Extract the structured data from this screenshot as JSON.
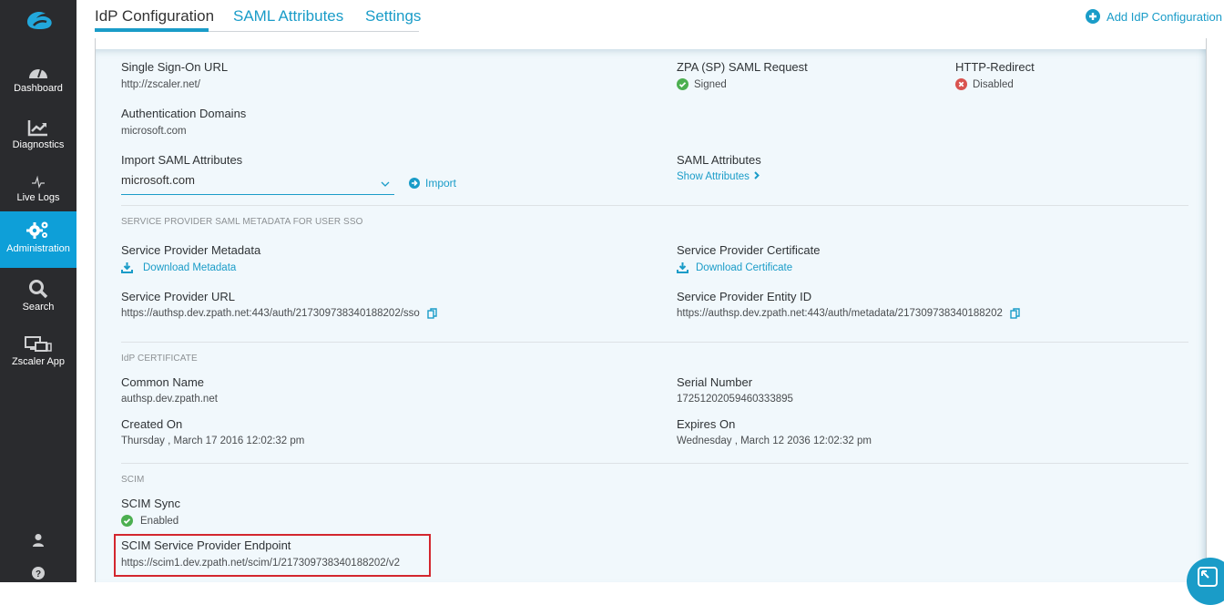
{
  "sidebar": {
    "logo": "zscaler-logo",
    "items": [
      {
        "label": "Dashboard",
        "icon": "gauge-icon",
        "active": false
      },
      {
        "label": "Diagnostics",
        "icon": "chart-trend-icon",
        "active": false
      },
      {
        "label": "Live Logs",
        "icon": "pulse-icon",
        "active": false
      },
      {
        "label": "Administration",
        "icon": "gears-icon",
        "active": true
      },
      {
        "label": "Search",
        "icon": "search-icon",
        "active": false
      },
      {
        "label": "Zscaler App",
        "icon": "devices-icon",
        "active": false
      }
    ],
    "bottom": [
      {
        "icon": "user-icon"
      },
      {
        "icon": "help-icon"
      }
    ]
  },
  "tabs": [
    {
      "label": "IdP Configuration",
      "active": true
    },
    {
      "label": "SAML Attributes",
      "active": false
    },
    {
      "label": "Settings",
      "active": false
    }
  ],
  "header": {
    "add_button": "Add IdP Configuration"
  },
  "colors": {
    "accent": "#1a9cc8",
    "sidebar_bg": "#2a2b2e",
    "active_nav": "#0e9fd8",
    "success": "#4caf50",
    "error": "#d9534f",
    "highlight": "#d3262e"
  },
  "config": {
    "sso_url": {
      "label": "Single Sign-On URL",
      "value": "http://zscaler.net/"
    },
    "sp_saml_request": {
      "label": "ZPA (SP) SAML Request",
      "value": "Signed",
      "status": "success"
    },
    "http_redirect": {
      "label": "HTTP-Redirect",
      "value": "Disabled",
      "status": "error"
    },
    "auth_domains": {
      "label": "Authentication Domains",
      "value": "microsoft.com"
    },
    "import_saml": {
      "label": "Import SAML Attributes",
      "selected": "microsoft.com",
      "import_button": "Import"
    },
    "saml_attributes": {
      "label": "SAML Attributes",
      "link": "Show Attributes"
    }
  },
  "sp_metadata": {
    "section_title": "SERVICE PROVIDER SAML METADATA FOR USER SSO",
    "metadata": {
      "label": "Service Provider Metadata",
      "link": "Download Metadata"
    },
    "certificate": {
      "label": "Service Provider Certificate",
      "link": "Download Certificate"
    },
    "url": {
      "label": "Service Provider URL",
      "value": "https://authsp.dev.zpath.net:443/auth/217309738340188202/sso"
    },
    "entity_id": {
      "label": "Service Provider Entity ID",
      "value": "https://authsp.dev.zpath.net:443/auth/metadata/217309738340188202"
    }
  },
  "idp_certificate": {
    "section_title": "IdP CERTIFICATE",
    "common_name": {
      "label": "Common Name",
      "value": "authsp.dev.zpath.net"
    },
    "serial_number": {
      "label": "Serial Number",
      "value": "17251202059460333895"
    },
    "created_on": {
      "label": "Created On",
      "value": "Thursday , March 17 2016 12:02:32 pm"
    },
    "expires_on": {
      "label": "Expires On",
      "value": "Wednesday , March 12 2036 12:02:32 pm"
    }
  },
  "scim": {
    "section_title": "SCIM",
    "sync": {
      "label": "SCIM Sync",
      "value": "Enabled",
      "status": "success"
    },
    "endpoint": {
      "label": "SCIM Service Provider Endpoint",
      "value": "https://scim1.dev.zpath.net/scim/1/217309738340188202/v2"
    }
  },
  "fab": {
    "icon": "expand-icon"
  }
}
